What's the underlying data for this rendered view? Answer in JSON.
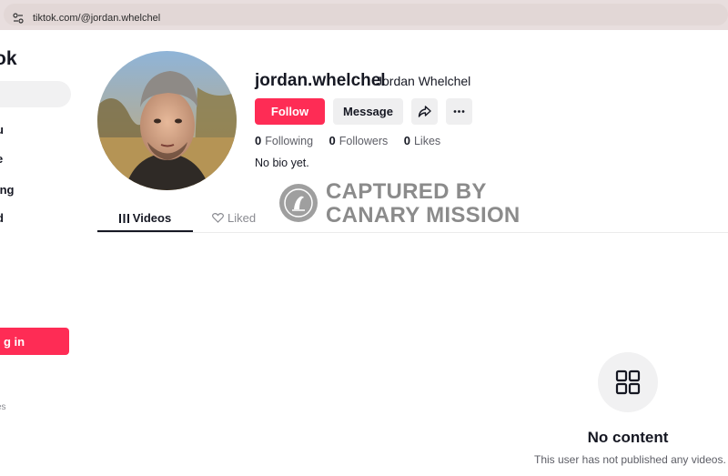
{
  "browser": {
    "url": "tiktok.com/@jordan.whelchel",
    "site_icon": "site-settings-icon"
  },
  "sidebar": {
    "logo": "ok",
    "items": [
      {
        "label": "u",
        "icon": "for-you-icon"
      },
      {
        "label": "e",
        "icon": "explore-icon"
      },
      {
        "label": "ing",
        "icon": "following-icon"
      },
      {
        "label": "d",
        "icon": "upload-icon"
      }
    ],
    "login_label": "g in",
    "footer_text": "es"
  },
  "profile": {
    "username": "jordan.whelchel",
    "display_name": "Jordan Whelchel",
    "follow_label": "Follow",
    "message_label": "Message",
    "share_icon": "share-icon",
    "more_icon": "more-icon",
    "stats": [
      {
        "value": "0",
        "label": "Following"
      },
      {
        "value": "0",
        "label": "Followers"
      },
      {
        "value": "0",
        "label": "Likes"
      }
    ],
    "bio": "No bio yet."
  },
  "tabs": [
    {
      "label": "Videos",
      "icon": "grid-lines-icon",
      "active": true
    },
    {
      "label": "Liked",
      "icon": "heart-outline-icon",
      "active": false
    }
  ],
  "watermark": {
    "line1": "CAPTURED BY",
    "line2": "CANARY MISSION"
  },
  "empty_state": {
    "icon": "grid-icon",
    "title": "No content",
    "subtitle": "This user has not published any videos."
  },
  "colors": {
    "accent": "#fe2c55",
    "text": "#161823",
    "muted": "#8a8b91",
    "button_bg": "#efeff0"
  }
}
